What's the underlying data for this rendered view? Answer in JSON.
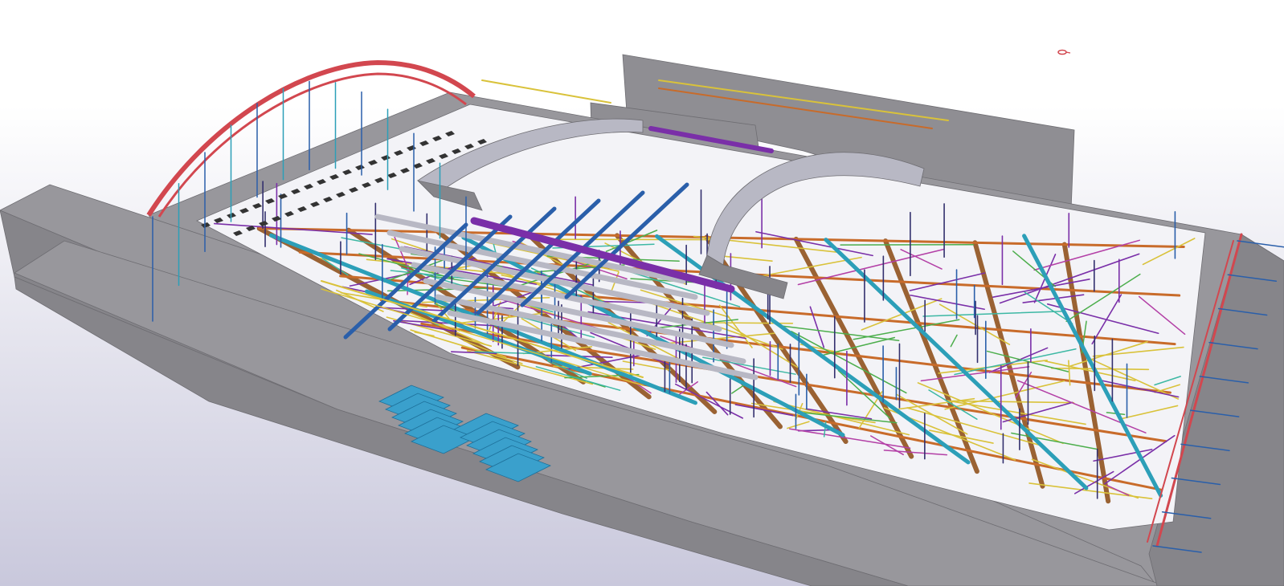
{
  "viewport": {
    "background_top": "#ffffff",
    "background_bottom": "#c9c8dc"
  },
  "colors": {
    "slab_top": "#98979c",
    "slab_side": "#86858a",
    "slab_edge": "#6e6d72",
    "wall": "#8f8e93",
    "arch_red": "#d2474f",
    "truss_yellow": "#d9c23a",
    "purple": "#7a2fa8",
    "magenta": "#b33fa6",
    "blue_dark": "#2a5faa",
    "cyan": "#2c9fb8",
    "teal": "#3db8a4",
    "green": "#4cae4c",
    "orange": "#c86b2a",
    "brown": "#9a6233",
    "navy": "#33306e",
    "steel_gray": "#b8b8c4",
    "stair_blue": "#3aa0cc"
  }
}
